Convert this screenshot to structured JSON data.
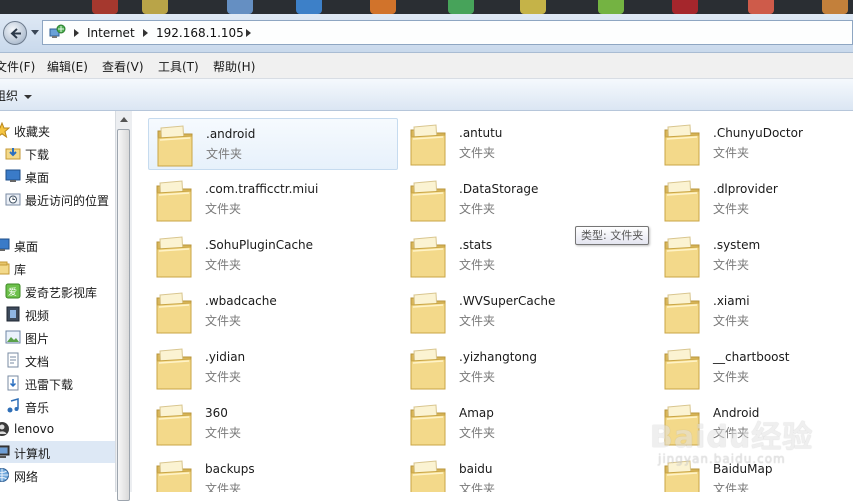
{
  "address_bar": {
    "crumbs": [
      "Internet",
      "192.168.1.105"
    ]
  },
  "menu": [
    "文件(F)",
    "编辑(E)",
    "查看(V)",
    "工具(T)",
    "帮助(H)"
  ],
  "command_bar": {
    "organize_label": "组织"
  },
  "nav_pane": {
    "items": [
      {
        "label": "收藏夹",
        "icon": "star-icon",
        "indent": 0
      },
      {
        "label": "下载",
        "icon": "download-folder-icon",
        "indent": 1
      },
      {
        "label": "桌面",
        "icon": "desktop-icon",
        "indent": 1
      },
      {
        "label": "最近访问的位置",
        "icon": "recent-places-icon",
        "indent": 1
      },
      {
        "label": "桌面",
        "icon": "desktop-icon",
        "indent": 0
      },
      {
        "label": "库",
        "icon": "library-icon",
        "indent": 0
      },
      {
        "label": "爱奇艺影视库",
        "icon": "iqiyi-library-icon",
        "indent": 1
      },
      {
        "label": "视频",
        "icon": "video-library-icon",
        "indent": 1
      },
      {
        "label": "图片",
        "icon": "picture-library-icon",
        "indent": 1
      },
      {
        "label": "文档",
        "icon": "document-library-icon",
        "indent": 1
      },
      {
        "label": "迅雷下载",
        "icon": "xunlei-download-icon",
        "indent": 1
      },
      {
        "label": "音乐",
        "icon": "music-library-icon",
        "indent": 1
      },
      {
        "label": "lenovo",
        "icon": "user-icon",
        "indent": 0
      },
      {
        "label": "计算机",
        "icon": "computer-icon",
        "indent": 0,
        "selected": true
      },
      {
        "label": "网络",
        "icon": "network-icon",
        "indent": 0
      }
    ]
  },
  "folders": [
    {
      "name": ".android",
      "type": "文件夹",
      "selected": true
    },
    {
      "name": ".antutu",
      "type": "文件夹"
    },
    {
      "name": ".ChunyuDoctor",
      "type": "文件夹"
    },
    {
      "name": ".com.trafficctr.miui",
      "type": "文件夹"
    },
    {
      "name": ".DataStorage",
      "type": "文件夹"
    },
    {
      "name": ".dlprovider",
      "type": "文件夹"
    },
    {
      "name": ".SohuPluginCache",
      "type": "文件夹"
    },
    {
      "name": ".stats",
      "type": "文件夹"
    },
    {
      "name": ".system",
      "type": "文件夹"
    },
    {
      "name": ".wbadcache",
      "type": "文件夹"
    },
    {
      "name": ".WVSuperCache",
      "type": "文件夹"
    },
    {
      "name": ".xiami",
      "type": "文件夹"
    },
    {
      "name": ".yidian",
      "type": "文件夹"
    },
    {
      "name": ".yizhangtong",
      "type": "文件夹"
    },
    {
      "name": "__chartboost",
      "type": "文件夹"
    },
    {
      "name": "360",
      "type": "文件夹"
    },
    {
      "name": "Amap",
      "type": "文件夹"
    },
    {
      "name": "Android",
      "type": "文件夹"
    },
    {
      "name": "backups",
      "type": "文件夹"
    },
    {
      "name": "baidu",
      "type": "文件夹"
    },
    {
      "name": "BaiduMap",
      "type": "文件夹"
    }
  ],
  "tooltip": "类型: 文件夹",
  "watermark": {
    "brand": "Baidu经验",
    "url": "jingyan.baidu.com"
  },
  "colors": {
    "folder": "#f3d98a",
    "folder_dark": "#d9b65a",
    "selection": "#dde8f5"
  }
}
